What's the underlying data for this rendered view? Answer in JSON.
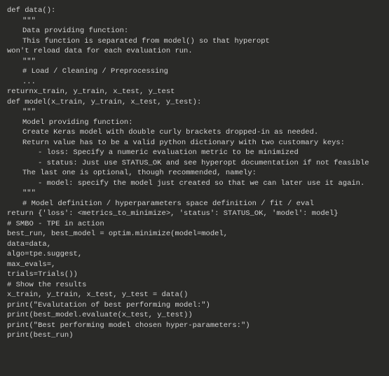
{
  "code": {
    "lines": [
      {
        "indent": 0,
        "text": "def data():"
      },
      {
        "indent": 1,
        "text": "\"\"\""
      },
      {
        "indent": 1,
        "text": "Data providing function:"
      },
      {
        "indent": 1,
        "text": "This function is separated from model() so that hyperopt"
      },
      {
        "indent": 0,
        "text": "won't reload data for each evaluation run."
      },
      {
        "indent": 1,
        "text": "\"\"\""
      },
      {
        "indent": 1,
        "text": "# Load / Cleaning / Preprocessing"
      },
      {
        "indent": 1,
        "text": "..."
      },
      {
        "indent": 0,
        "text": "returnx_train, y_train, x_test, y_test"
      },
      {
        "indent": 0,
        "text": "def model(x_train, y_train, x_test, y_test):"
      },
      {
        "indent": 1,
        "text": "\"\"\""
      },
      {
        "indent": 1,
        "text": "Model providing function:"
      },
      {
        "indent": 1,
        "text": "Create Keras model with double curly brackets dropped-in as needed."
      },
      {
        "indent": 1,
        "text": "Return value has to be a valid python dictionary with two customary keys:"
      },
      {
        "indent": 2,
        "text": "- loss: Specify a numeric evaluation metric to be minimized"
      },
      {
        "indent": 2,
        "text": "- status: Just use STATUS_OK and see hyperopt documentation if not feasible"
      },
      {
        "indent": 1,
        "text": "The last one is optional, though recommended, namely:"
      },
      {
        "indent": 2,
        "text": "- model: specify the model just created so that we can later use it again."
      },
      {
        "indent": 1,
        "text": "\"\"\""
      },
      {
        "indent": 1,
        "text": "# Model definition / hyperparameters space definition / fit / eval"
      },
      {
        "indent": 0,
        "text": "return {'loss': <metrics_to_minimize>, 'status': STATUS_OK, 'model': model}"
      },
      {
        "indent": 0,
        "text": "# SMBO - TPE in action"
      },
      {
        "indent": 0,
        "text": "best_run, best_model = optim.minimize(model=model,"
      },
      {
        "indent": 0,
        "text": "data=data,"
      },
      {
        "indent": 0,
        "text": "algo=tpe.suggest,"
      },
      {
        "indent": 0,
        "text": "max_evals=,"
      },
      {
        "indent": 0,
        "text": "trials=Trials())"
      },
      {
        "indent": 0,
        "text": "# Show the results"
      },
      {
        "indent": 0,
        "text": "x_train, y_train, x_test, y_test = data()"
      },
      {
        "indent": 0,
        "text": "print(\"Evalutation of best performing model:\")"
      },
      {
        "indent": 0,
        "text": "print(best_model.evaluate(x_test, y_test))"
      },
      {
        "indent": 0,
        "text": "print(\"Best performing model chosen hyper-parameters:\")"
      },
      {
        "indent": 0,
        "text": "print(best_run)"
      }
    ]
  }
}
